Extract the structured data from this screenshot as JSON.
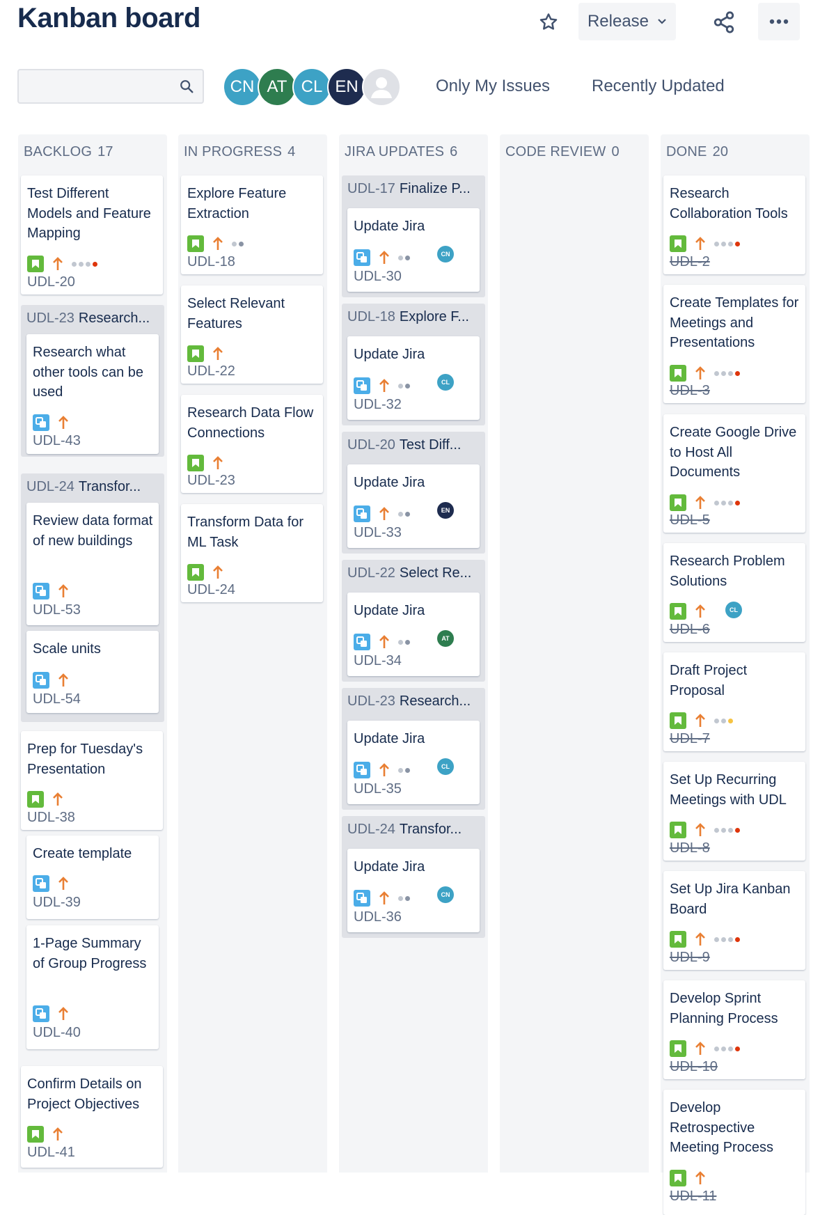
{
  "header": {
    "title": "Kanban board",
    "release_label": "Release"
  },
  "toolbar": {
    "search_placeholder": "",
    "avatars": [
      {
        "initials": "CN",
        "color": "#3DA2C5"
      },
      {
        "initials": "AT",
        "color": "#2E7D4F"
      },
      {
        "initials": "CL",
        "color": "#3DA2C5"
      },
      {
        "initials": "EN",
        "color": "#1E2C4F"
      }
    ],
    "quick_filters": [
      "Only My Issues",
      "Recently Updated"
    ]
  },
  "colors": {
    "story": "#63BA3C",
    "subtask": "#4BADE8",
    "priority": "#E97F33",
    "dot_red": "#DE350B",
    "dot_yellow": "#F6C342"
  },
  "columns": [
    {
      "name": "BACKLOG",
      "count": "17"
    },
    {
      "name": "IN PROGRESS",
      "count": "4"
    },
    {
      "name": "JIRA UPDATES",
      "count": "6"
    },
    {
      "name": "CODE REVIEW",
      "count": "0"
    },
    {
      "name": "DONE",
      "count": "20"
    }
  ],
  "backlog": {
    "c1": {
      "title": "Test Different Models and Feature Mapping",
      "key": "UDL-20"
    },
    "g1": {
      "key": "UDL-23",
      "title": "Research...",
      "card": {
        "title": "Research what other tools can be used",
        "key": "UDL-43"
      }
    },
    "g2": {
      "key": "UDL-24",
      "title": "Transfor...",
      "cards": [
        {
          "title": "Review data format of new buildings",
          "key": "UDL-53"
        },
        {
          "title": "Scale units",
          "key": "UDL-54"
        }
      ]
    },
    "c2": {
      "title": "Prep for Tuesday's Presentation",
      "key": "UDL-38"
    },
    "sub": [
      {
        "title": "Create template",
        "key": "UDL-39"
      },
      {
        "title": "1-Page Summary of Group Progress",
        "key": "UDL-40"
      }
    ],
    "c3": {
      "title": "Confirm Details on Project Objectives",
      "key": "UDL-41"
    }
  },
  "in_progress": [
    {
      "title": "Explore Feature Extraction",
      "key": "UDL-18"
    },
    {
      "title": "Select Relevant Features",
      "key": "UDL-22"
    },
    {
      "title": "Research Data Flow Connections",
      "key": "UDL-23"
    },
    {
      "title": "Transform Data for ML Task",
      "key": "UDL-24"
    }
  ],
  "jira_updates": [
    {
      "gkey": "UDL-17",
      "gtitle": "Finalize P...",
      "title": "Update Jira",
      "key": "UDL-30",
      "assignee": "CN"
    },
    {
      "gkey": "UDL-18",
      "gtitle": "Explore F...",
      "title": "Update Jira",
      "key": "UDL-32",
      "assignee": "CL"
    },
    {
      "gkey": "UDL-20",
      "gtitle": "Test Diff...",
      "title": "Update Jira",
      "key": "UDL-33",
      "assignee": "EN"
    },
    {
      "gkey": "UDL-22",
      "gtitle": "Select Re...",
      "title": "Update Jira",
      "key": "UDL-34",
      "assignee": "AT"
    },
    {
      "gkey": "UDL-23",
      "gtitle": "Research...",
      "title": "Update Jira",
      "key": "UDL-35",
      "assignee": "CL"
    },
    {
      "gkey": "UDL-24",
      "gtitle": "Transfor...",
      "title": "Update Jira",
      "key": "UDL-36",
      "assignee": "CN"
    }
  ],
  "done": [
    {
      "title": "Research Collaboration Tools",
      "key": "UDL-2"
    },
    {
      "title": "Create Templates for Meetings and Presentations",
      "key": "UDL-3"
    },
    {
      "title": "Create Google Drive to Host All Documents",
      "key": "UDL-5"
    },
    {
      "title": "Research Problem Solutions",
      "key": "UDL-6",
      "assignee": "CL"
    },
    {
      "title": "Draft Project Proposal",
      "key": "UDL-7"
    },
    {
      "title": "Set Up Recurring Meetings with UDL",
      "key": "UDL-8"
    },
    {
      "title": "Set Up Jira Kanban Board",
      "key": "UDL-9"
    },
    {
      "title": "Develop Sprint Planning Process",
      "key": "UDL-10"
    },
    {
      "title": "Develop Retrospective Meeting Process",
      "key": "UDL-11"
    }
  ]
}
